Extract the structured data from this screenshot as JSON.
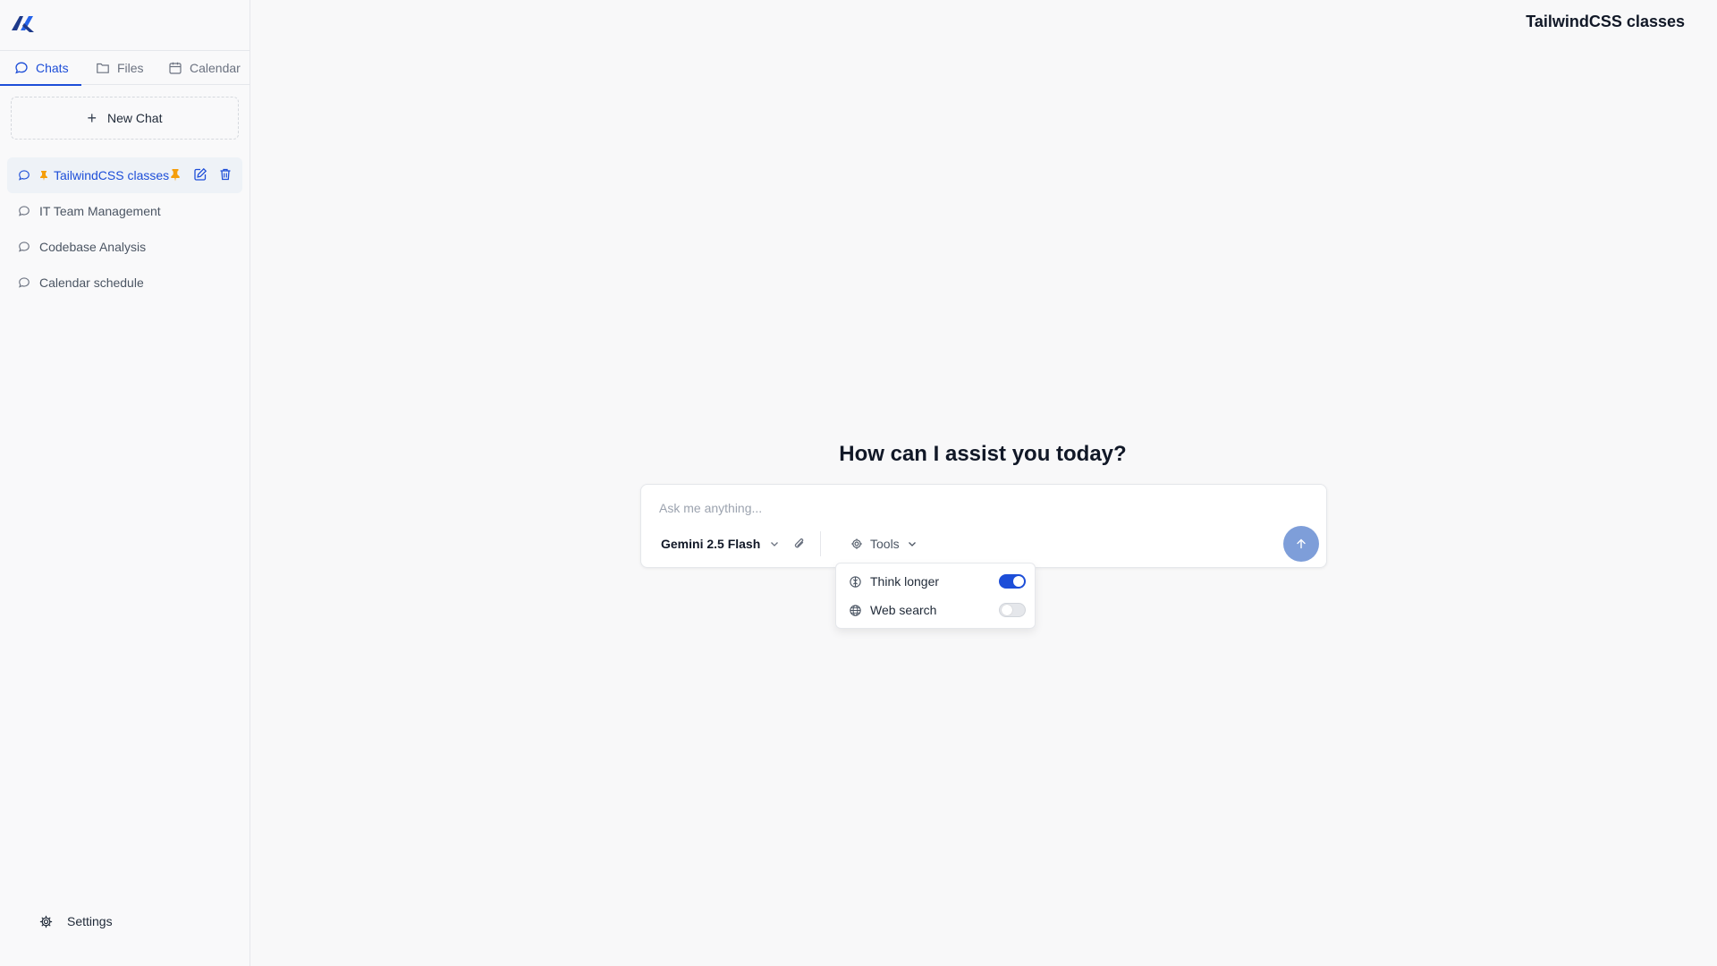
{
  "app": {
    "logo_icon": "app-logo-icon",
    "header_title": "TailwindCSS classes"
  },
  "sidebar": {
    "tabs": [
      {
        "label": "Chats",
        "icon": "chat-bubble-icon",
        "active": true
      },
      {
        "label": "Files",
        "icon": "folder-icon",
        "active": false
      },
      {
        "label": "Calendar",
        "icon": "calendar-icon",
        "active": false
      }
    ],
    "new_chat_label": "New Chat",
    "chats": [
      {
        "label": "TailwindCSS classes",
        "pinned": true,
        "active": true
      },
      {
        "label": "IT Team Management",
        "pinned": false,
        "active": false
      },
      {
        "label": "Codebase Analysis",
        "pinned": false,
        "active": false
      },
      {
        "label": "Calendar schedule",
        "pinned": false,
        "active": false
      }
    ],
    "settings_label": "Settings"
  },
  "main": {
    "headline": "How can I assist you today?",
    "composer": {
      "placeholder": "Ask me anything...",
      "model": "Gemini 2.5 Flash",
      "tools_label": "Tools"
    },
    "tools_menu": {
      "items": [
        {
          "label": "Think longer",
          "icon": "brain-icon",
          "enabled": true
        },
        {
          "label": "Web search",
          "icon": "globe-icon",
          "enabled": false
        }
      ]
    }
  },
  "colors": {
    "accent": "#1d4ed8",
    "pin": "#f59e0b",
    "send_button": "#7e9ed9",
    "background": "#f8f8f9"
  }
}
